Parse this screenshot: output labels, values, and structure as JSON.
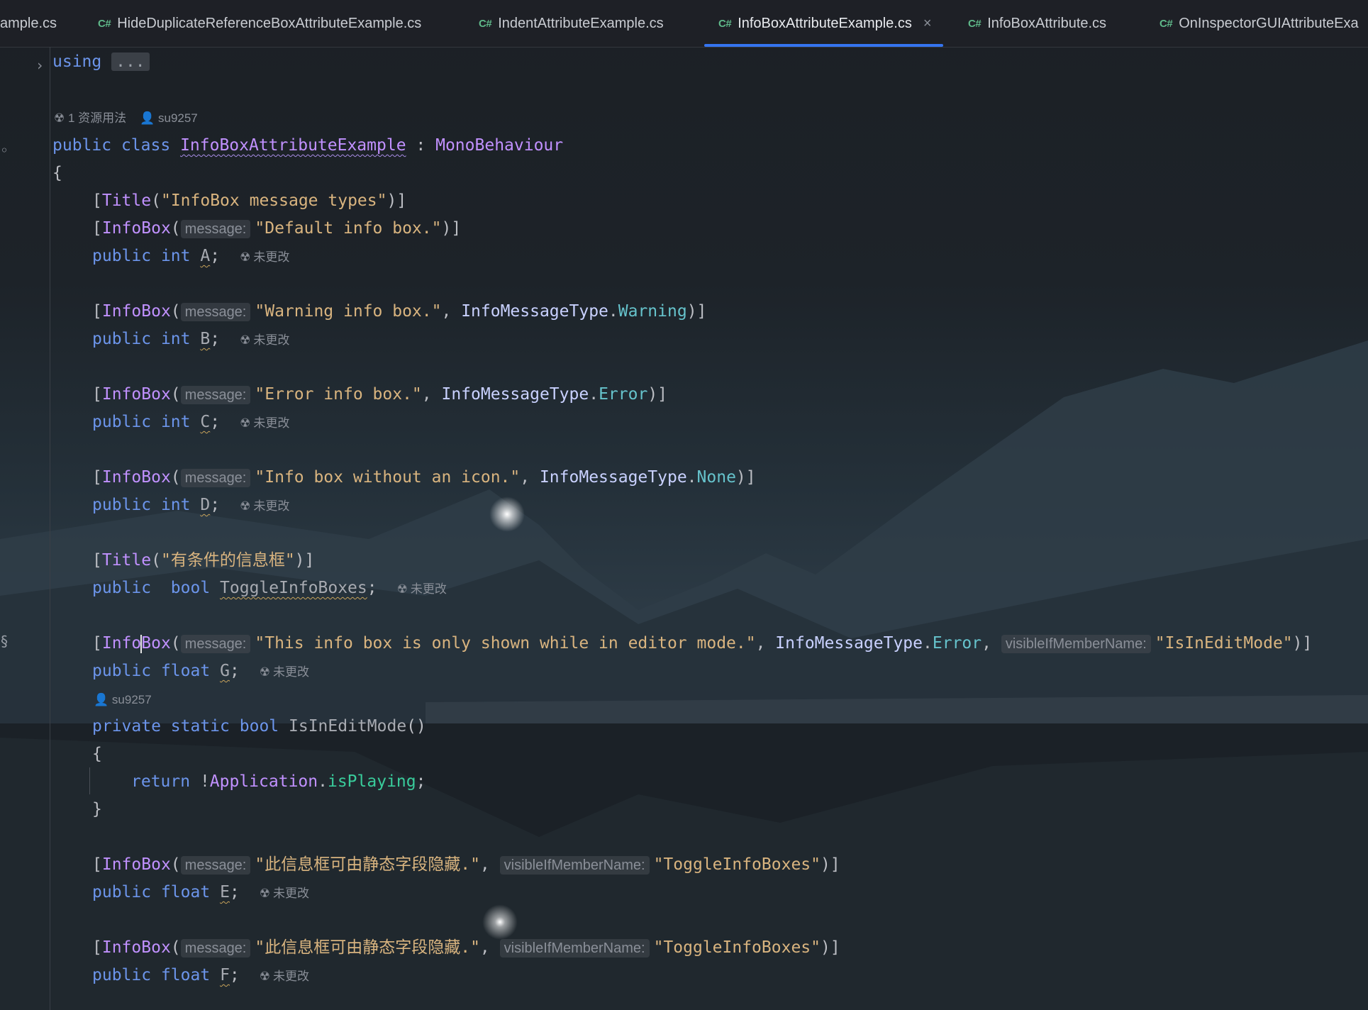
{
  "tabs": [
    {
      "label": "ample.cs",
      "badge": ""
    },
    {
      "label": "HideDuplicateReferenceBoxAttributeExample.cs",
      "badge": "C#"
    },
    {
      "label": "IndentAttributeExample.cs",
      "badge": "C#"
    },
    {
      "label": "InfoBoxAttributeExample.cs",
      "badge": "C#",
      "active": true
    },
    {
      "label": "InfoBoxAttribute.cs",
      "badge": "C#"
    },
    {
      "label": "OnInspectorGUIAttributeExa",
      "badge": "C#"
    }
  ],
  "editor": {
    "using_kw": "using",
    "using_fold": "...",
    "lens_usage": "1 资源用法",
    "lens_author": "su9257",
    "unchanged": "未更改",
    "hint_message": "message:",
    "hint_visible": "visibleIfMemberName:",
    "class_line": {
      "public": "public",
      "class": "class",
      "name": "InfoBoxAttributeExample",
      "colon": " : ",
      "base": "MonoBehaviour"
    },
    "brace_open": "{",
    "brace_close": "}",
    "title1": "\"InfoBox message types\"",
    "title_kw": "Title",
    "infobox_kw": "InfoBox",
    "msg_default": "\"Default info box.\"",
    "msg_warning": "\"Warning info box.\"",
    "msg_error": "\"Error info box.\"",
    "msg_none": "\"Info box without an icon.\"",
    "imt": "InfoMessageType",
    "warning": "Warning",
    "error": "Error",
    "none": "None",
    "public": "public",
    "int": "int",
    "float": "float",
    "bool": "bool",
    "private": "private",
    "static": "static",
    "return": "return",
    "field_a": "A",
    "field_b": "B",
    "field_c": "C",
    "field_d": "D",
    "field_toggle": "ToggleInfoBoxes",
    "field_g": "G",
    "field_e": "E",
    "field_f": "F",
    "title2": "\"有条件的信息框\"",
    "msg_editor": "\"This info box is only shown while in editor mode.\"",
    "is_in_edit_mode_str": "\"IsInEditMode\"",
    "method_name": "IsInEditMode",
    "application": "Application",
    "is_playing": "isPlaying",
    "msg_static": "\"此信息框可由静态字段隐藏.\"",
    "toggle_str": "\"ToggleInfoBoxes\""
  }
}
